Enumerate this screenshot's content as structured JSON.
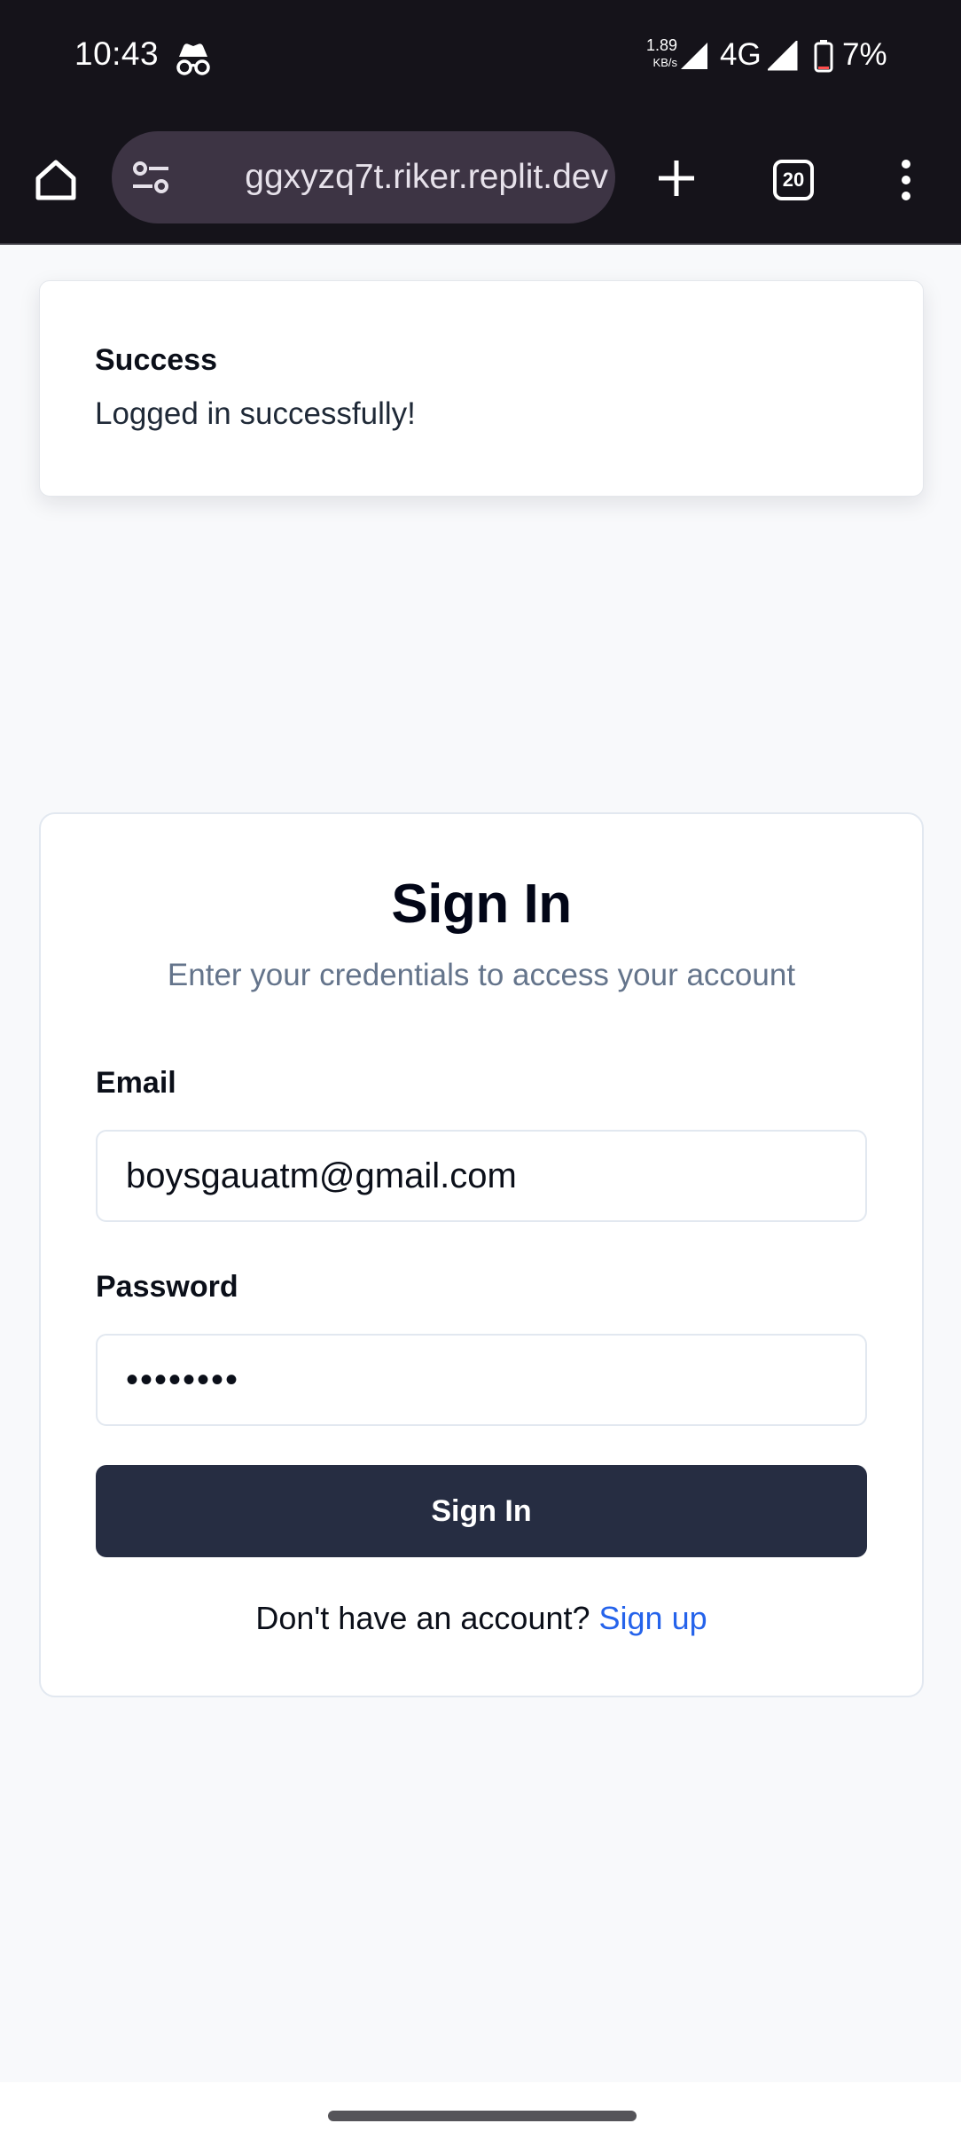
{
  "status_bar": {
    "time": "10:43",
    "net_speed_value": "1.89",
    "net_speed_unit": "KB/s",
    "network_type": "4G",
    "battery": "7%"
  },
  "browser": {
    "url": "ggxyzq7t.riker.replit.dev",
    "tab_count": "20"
  },
  "toast": {
    "title": "Success",
    "description": "Logged in successfully!"
  },
  "signin": {
    "title": "Sign In",
    "subtitle": "Enter your credentials to access your account",
    "email_label": "Email",
    "email_value": "boysgauatm@gmail.com",
    "password_label": "Password",
    "password_value": "••••••••",
    "submit_label": "Sign In",
    "signup_prompt": "Don't have an account?",
    "signup_link": "Sign up"
  },
  "colors": {
    "status_bar_bg": "#15131a",
    "omnibox_bg": "#3d3444",
    "page_bg": "#f8f9fb",
    "button_bg": "#262d42",
    "link": "#2563eb",
    "subtitle": "#64748b"
  },
  "icons": [
    "incognito-icon",
    "signal-icon",
    "battery-icon",
    "home-icon",
    "site-settings-icon",
    "new-tab-icon",
    "tab-switcher-icon",
    "more-menu-icon"
  ]
}
